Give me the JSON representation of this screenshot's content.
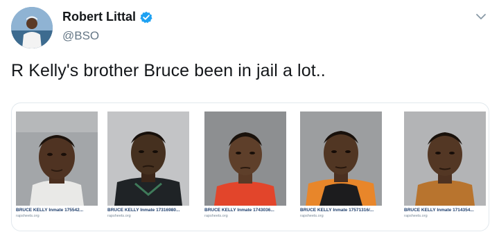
{
  "author": {
    "display_name": "Robert Littal",
    "handle": "@BSO",
    "verified": true
  },
  "tweet": {
    "text": "R Kelly's brother Bruce been in jail a lot.."
  },
  "icons": {
    "verified": "verified-badge-icon",
    "menu": "chevron-down-icon"
  },
  "colors": {
    "verified_blue": "#1da1f2",
    "muted_text": "#657786",
    "border": "#e1e8ed"
  },
  "image_results": [
    {
      "caption": "BRUCE KELLY Inmate 175542...",
      "source": "rapsheets.org"
    },
    {
      "caption": "BRUCE KELLY Inmate 17316980...",
      "source": "rapsheets.org"
    },
    {
      "caption": "BRUCE KELLY Inmate 1743036...",
      "source": "rapsheets.org"
    },
    {
      "caption": "BRUCE KELLY Inmate 17571316/...",
      "source": "rapsheets.org"
    },
    {
      "caption": "BRUCE KELLY Inmate 1714354...",
      "source": "rapsheets.org"
    }
  ]
}
